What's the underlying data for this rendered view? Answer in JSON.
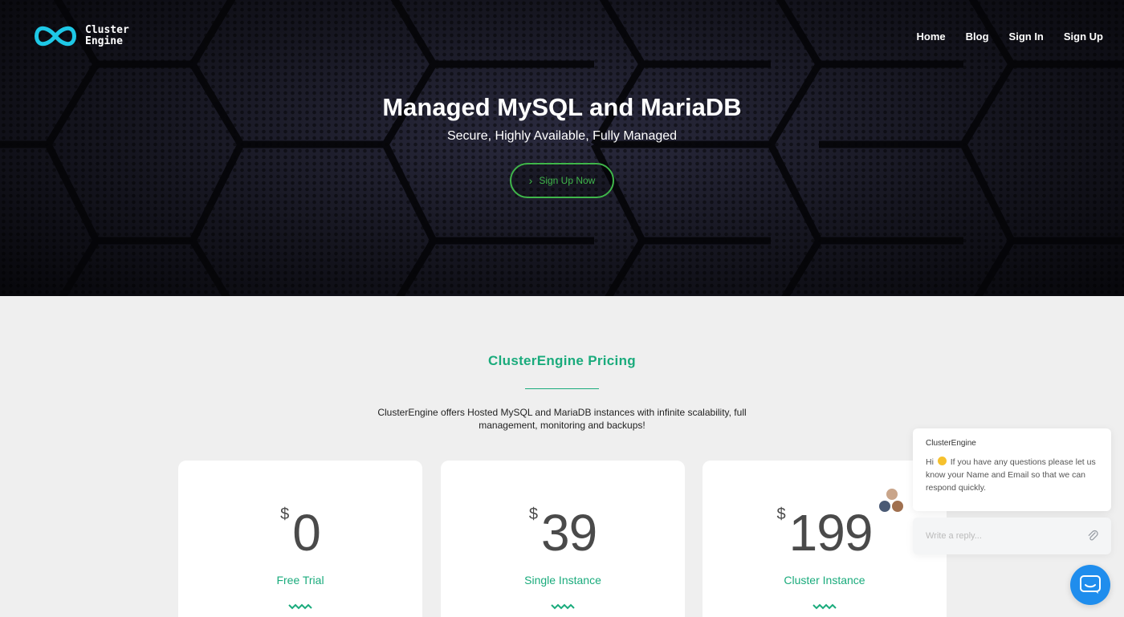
{
  "header": {
    "logo_line1": "Cluster",
    "logo_line2": "Engine",
    "nav": [
      "Home",
      "Blog",
      "Sign In",
      "Sign Up"
    ]
  },
  "hero": {
    "title": "Managed MySQL and MariaDB",
    "subtitle": "Secure, Highly Available, Fully Managed",
    "cta_label": "Sign Up Now"
  },
  "pricing": {
    "title": "ClusterEngine Pricing",
    "description": "ClusterEngine offers Hosted MySQL and MariaDB instances with infinite scalability, full management, monitoring and backups!",
    "plans": [
      {
        "currency": "$",
        "amount": "0",
        "name": "Free Trial"
      },
      {
        "currency": "$",
        "amount": "39",
        "name": "Single Instance"
      },
      {
        "currency": "$",
        "amount": "199",
        "name": "Cluster Instance"
      }
    ]
  },
  "chat": {
    "sender": "ClusterEngine",
    "greeting": "Hi",
    "message": "If you have any questions please let us know your Name and Email so that we can respond quickly.",
    "reply_placeholder": "Write a reply..."
  },
  "colors": {
    "accent": "#1aab7c",
    "cta": "#3fb54a",
    "logo": "#1ec8e6",
    "launcher": "#1f8ded"
  }
}
